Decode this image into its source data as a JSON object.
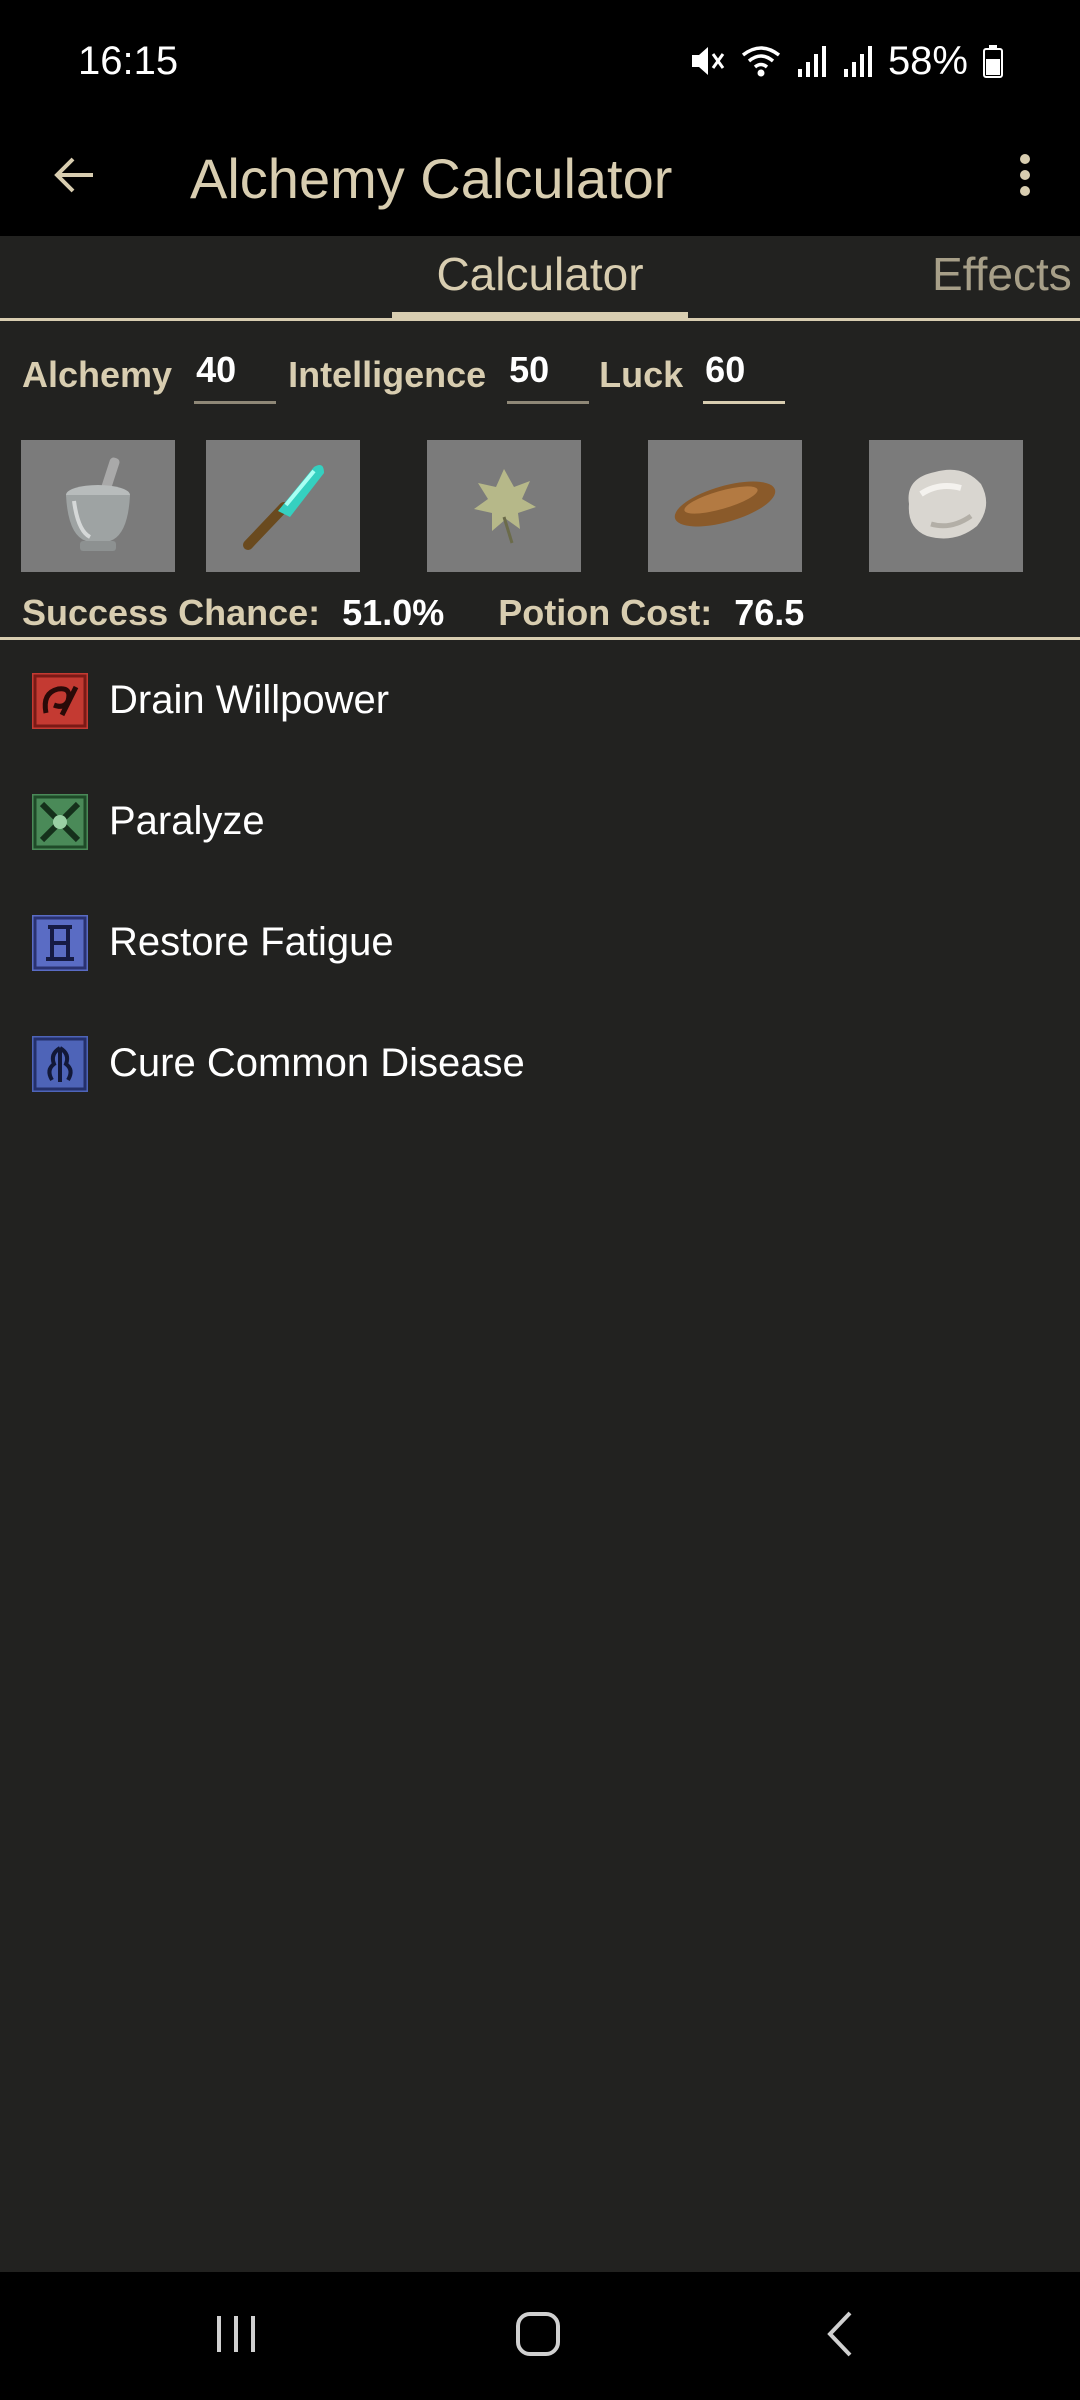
{
  "status_bar": {
    "time": "16:15",
    "battery": "58%",
    "icons": [
      "mute-icon",
      "wifi-icon",
      "signal-icon",
      "signal-icon",
      "battery-icon"
    ]
  },
  "app_bar": {
    "title": "Alchemy Calculator",
    "back_icon": "arrow-back-icon",
    "menu_icon": "more-vert-icon"
  },
  "tabs": [
    {
      "label": "Calculator",
      "selected": true
    },
    {
      "label": "Effects",
      "selected": false
    }
  ],
  "stats": {
    "alchemy_label": "Alchemy",
    "alchemy_value": "40",
    "intelligence_label": "Intelligence",
    "intelligence_value": "50",
    "luck_label": "Luck",
    "luck_value": "60"
  },
  "ingredients": [
    {
      "icon": "mortar-and-pestle-icon"
    },
    {
      "icon": "alembic-icon"
    },
    {
      "icon": "leaf-icon"
    },
    {
      "icon": "root-icon"
    },
    {
      "icon": "stone-icon"
    }
  ],
  "summary": {
    "success_label": "Success Chance:",
    "success_value": "51.0%",
    "cost_label": "Potion Cost:",
    "cost_value": "76.5"
  },
  "effects": [
    {
      "label": "Drain Willpower",
      "icon": "drain-willpower-icon"
    },
    {
      "label": "Paralyze",
      "icon": "paralyze-icon"
    },
    {
      "label": "Restore Fatigue",
      "icon": "restore-fatigue-icon"
    },
    {
      "label": "Cure Common Disease",
      "icon": "cure-disease-icon"
    }
  ],
  "colors": {
    "background": "#222220",
    "bar": "#000000",
    "accent": "#d8cdb0",
    "text": "#ffffff",
    "slot": "#7b7b7b"
  },
  "nav_bar": {
    "icons": [
      "recent-apps-icon",
      "home-icon",
      "back-icon"
    ]
  }
}
